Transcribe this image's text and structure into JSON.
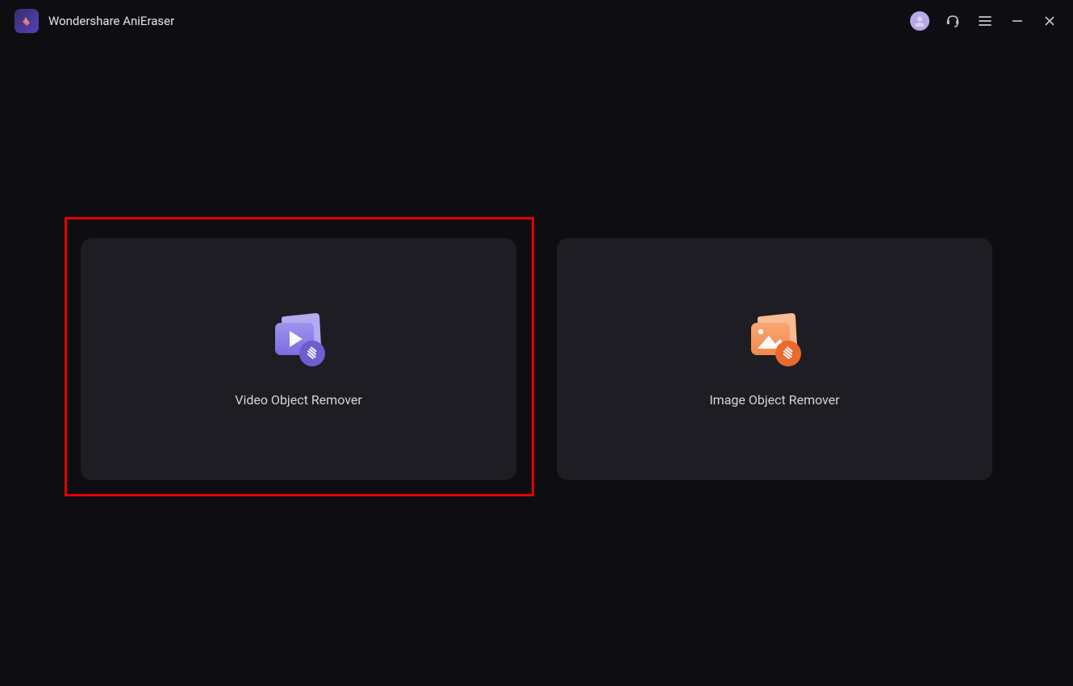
{
  "app": {
    "title": "Wondershare AniEraser"
  },
  "cards": {
    "video": {
      "label": "Video Object Remover"
    },
    "image": {
      "label": "Image Object Remover"
    }
  },
  "colors": {
    "accent_purple": "#8b7ee6",
    "accent_purple_dark": "#6b5ed0",
    "accent_orange": "#f5935a",
    "accent_orange_dark": "#ea6a2e",
    "highlight_red": "#e60000"
  }
}
